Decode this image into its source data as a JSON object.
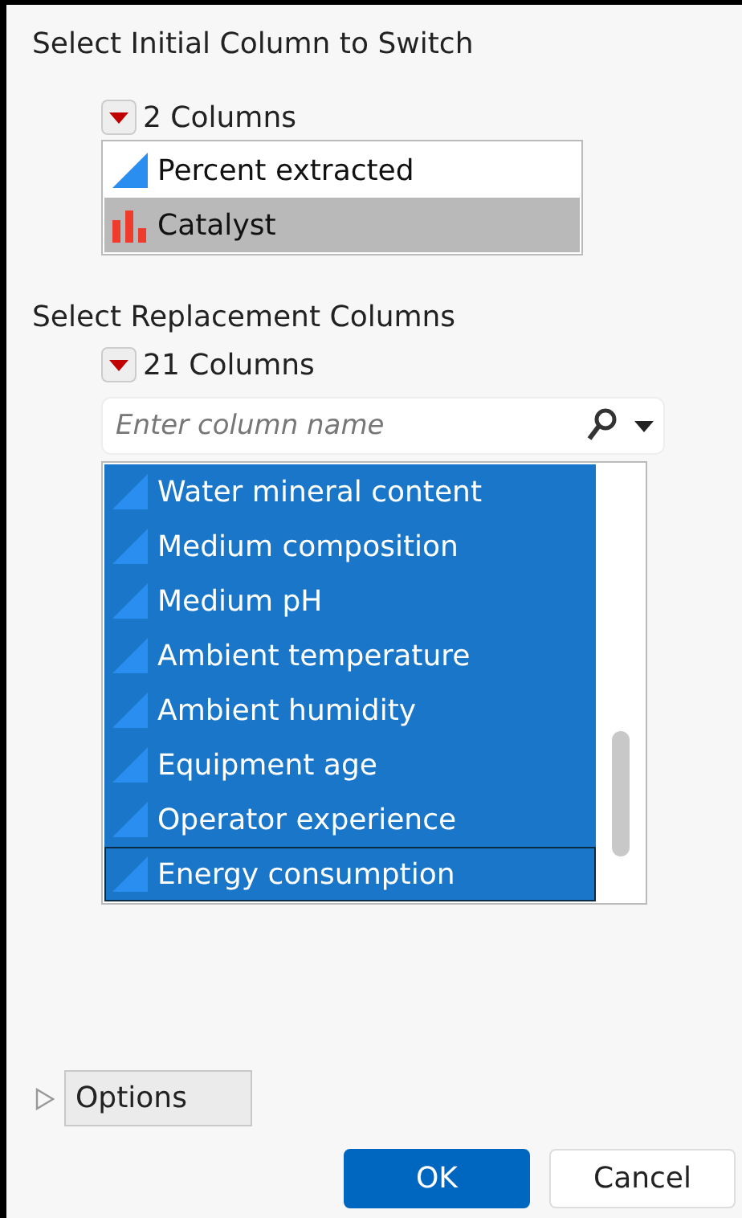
{
  "initial_section": {
    "title": "Select Initial Column to Switch",
    "count_label": "2 Columns",
    "items": [
      {
        "name": "Percent extracted",
        "kind": "continuous",
        "selected": false
      },
      {
        "name": "Catalyst",
        "kind": "nominal",
        "selected": true
      }
    ]
  },
  "replacement_section": {
    "title": "Select Replacement Columns",
    "count_label": "21 Columns",
    "search": {
      "placeholder": "Enter column name"
    },
    "items": [
      {
        "name": "Water mineral content",
        "kind": "continuous",
        "selected": true,
        "focused": false
      },
      {
        "name": "Medium composition",
        "kind": "continuous",
        "selected": true,
        "focused": false
      },
      {
        "name": "Medium pH",
        "kind": "continuous",
        "selected": true,
        "focused": false
      },
      {
        "name": "Ambient temperature",
        "kind": "continuous",
        "selected": true,
        "focused": false
      },
      {
        "name": "Ambient humidity",
        "kind": "continuous",
        "selected": true,
        "focused": false
      },
      {
        "name": "Equipment age",
        "kind": "continuous",
        "selected": true,
        "focused": false
      },
      {
        "name": "Operator experience",
        "kind": "continuous",
        "selected": true,
        "focused": false
      },
      {
        "name": "Energy consumption",
        "kind": "continuous",
        "selected": true,
        "focused": true
      }
    ]
  },
  "options": {
    "label": "Options",
    "expanded": false
  },
  "buttons": [
    {
      "label": "OK",
      "kind": "primary"
    },
    {
      "label": "Cancel",
      "kind": "secondary"
    }
  ]
}
